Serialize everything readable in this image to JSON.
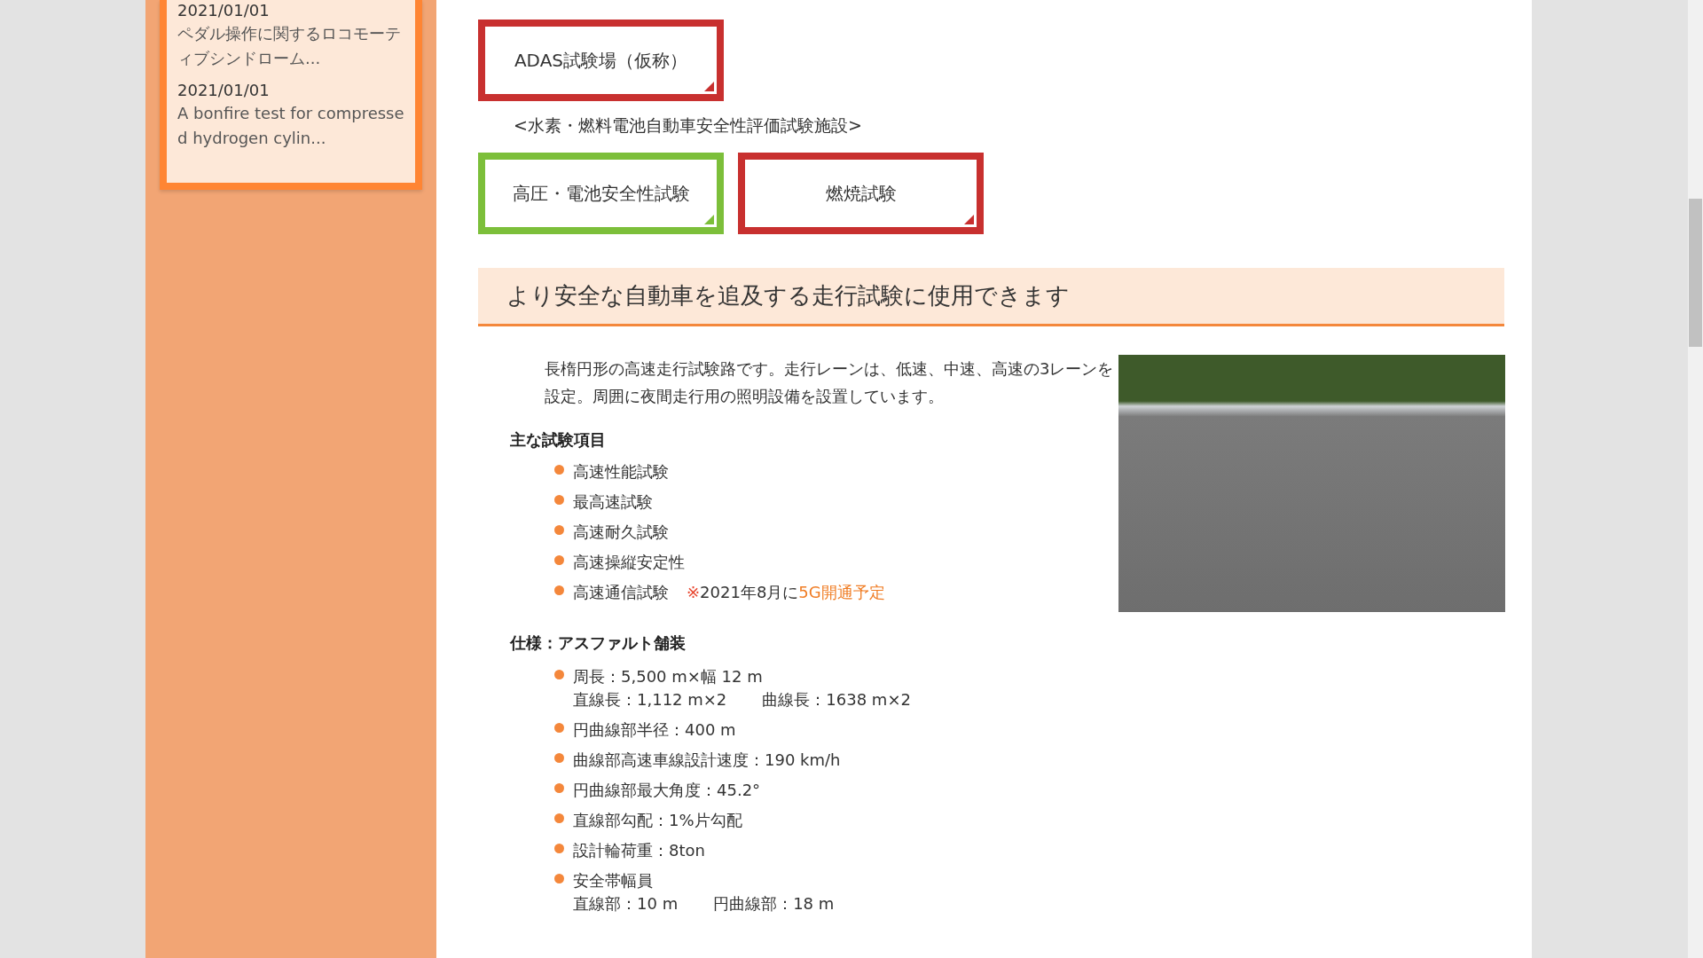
{
  "sidebar": {
    "news": [
      {
        "date": "2021/01/01",
        "title": "ペダル操作に関するロコモーティブシンドローム..."
      },
      {
        "date": "2021/01/01",
        "title": "A bonfire test for compressed hydrogen cylin..."
      }
    ]
  },
  "facility_links": [
    {
      "label": "ADAS試験場（仮称）",
      "color": "#c8302f"
    }
  ],
  "facility_group": {
    "title": "<水素・燃料電池自動車安全性評価試験施設>",
    "links": [
      {
        "label": "高圧・電池安全性試験",
        "color": "#7cbf3a"
      },
      {
        "label": "燃焼試験",
        "color": "#c8302f"
      }
    ]
  },
  "section": {
    "heading": "より安全な自動車を追及する走行試験に使用できます",
    "description": "長楕円形の高速走行試験路です。走行レーンは、低速、中速、高速の3レーンを設定。周囲に夜間走行用の照明設備を設置しています。",
    "test_items": {
      "title": "主な試験項目",
      "items": [
        {
          "text": "高速性能試験"
        },
        {
          "text": "最高速試験"
        },
        {
          "text": "高速耐久試験"
        },
        {
          "text": "高速操縦安定性"
        },
        {
          "text": "高速通信試験",
          "note": [
            {
              "kind": "mark",
              "text": "※"
            },
            {
              "kind": "plain",
              "text": "2021年8月に"
            },
            {
              "kind": "highlight",
              "text": "5G開通予定"
            }
          ]
        }
      ]
    },
    "specs": {
      "title": "仕様：アスファルト舗装",
      "items": [
        {
          "lines": [
            [
              "周長：5,500 m×幅 12 m"
            ],
            [
              "直線長：1,112 m×2",
              "曲線長：1638 m×2"
            ]
          ]
        },
        {
          "lines": [
            [
              "円曲線部半径：400 m"
            ]
          ]
        },
        {
          "lines": [
            [
              "曲線部高速車線設計速度：190 km/h"
            ]
          ]
        },
        {
          "lines": [
            [
              "円曲線部最大角度：45.2°"
            ]
          ]
        },
        {
          "lines": [
            [
              "直線部勾配：1%片勾配"
            ]
          ]
        },
        {
          "lines": [
            [
              "設計輪荷重：8ton"
            ]
          ]
        },
        {
          "lines": [
            [
              "安全帯幅員"
            ],
            [
              "直線部：10 m",
              "円曲線部：18 m"
            ]
          ]
        }
      ]
    }
  }
}
